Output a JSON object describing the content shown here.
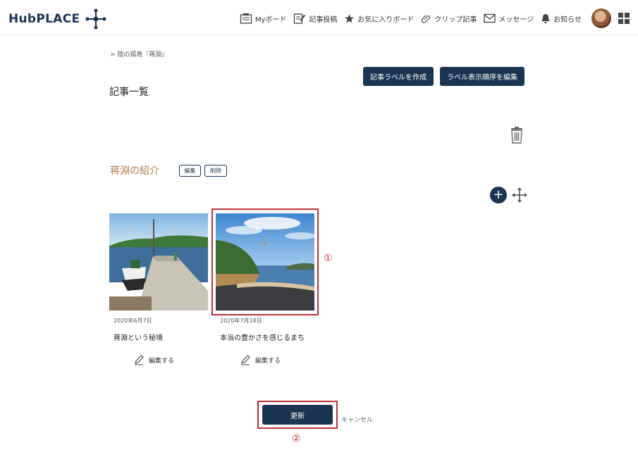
{
  "header": {
    "logo": "HubPLACE",
    "nav": [
      {
        "label": "Myボード",
        "icon": "board-icon"
      },
      {
        "label": "記事投稿",
        "icon": "post-icon"
      },
      {
        "label": "お気に入りボード",
        "icon": "star-icon"
      },
      {
        "label": "クリップ記事",
        "icon": "clip-icon"
      },
      {
        "label": "メッセージ",
        "icon": "mail-icon"
      },
      {
        "label": "お知らせ",
        "icon": "bell-icon"
      }
    ]
  },
  "breadcrumb": "> 陸の孤島『蒋淵』",
  "buttons": {
    "create_label": "記事ラベルを作成",
    "edit_order": "ラベル表示順序を編集",
    "update": "更新",
    "cancel": "キャンセル"
  },
  "page_title": "記事一覧",
  "section": {
    "title": "蒋淵の紹介",
    "edit": "編集",
    "delete": "削除"
  },
  "articles": [
    {
      "date": "2020年6月7日",
      "title": "蒋淵という秘境",
      "edit": "編集する"
    },
    {
      "date": "2020年7月18日",
      "title": "本当の豊かさを感じるまち",
      "edit": "編集する"
    }
  ],
  "annotations": {
    "first": "①",
    "second": "②"
  },
  "colors": {
    "primary": "#1a3552",
    "accent_title": "#b07a4a",
    "highlight": "#c0303a"
  }
}
